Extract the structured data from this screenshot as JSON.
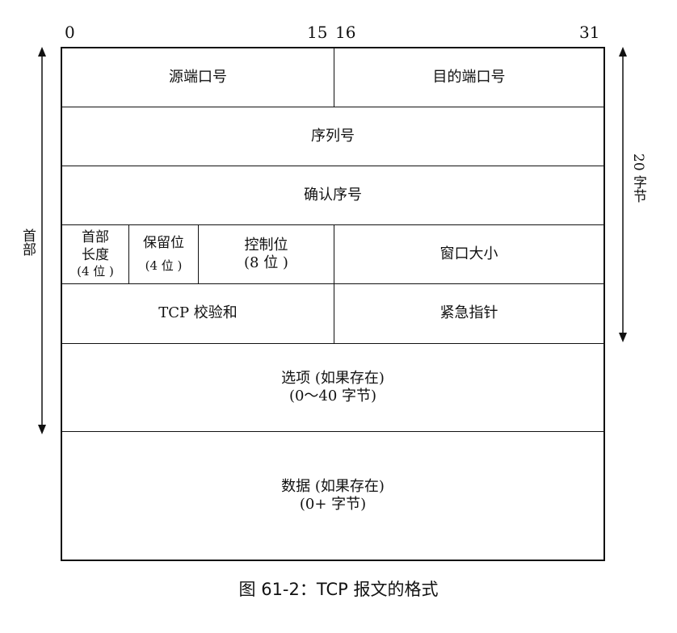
{
  "bits": {
    "b0": "0",
    "b15": "15",
    "b16": "16",
    "b31": "31"
  },
  "fields": {
    "src_port": "源端口号",
    "dst_port": "目的端口号",
    "seq": "序列号",
    "ack": "确认序号",
    "hdr_len_1": "首部",
    "hdr_len_2": "长度",
    "hdr_len_3": "(4 位 )",
    "reserved_1": "保留位",
    "reserved_2": "(4 位 )",
    "control_1": "控制位",
    "control_2": "(8 位 )",
    "window": "窗口大小",
    "checksum": "TCP 校验和",
    "urgent": "紧急指针",
    "options_1": "选项 (如果存在)",
    "options_2": "(0～40 字节)",
    "data_1": "数据 (如果存在)",
    "data_2": "(0+ 字节)"
  },
  "left_label": "首部",
  "right_label": "20 字节",
  "caption": "图 61-2：TCP 报文的格式"
}
